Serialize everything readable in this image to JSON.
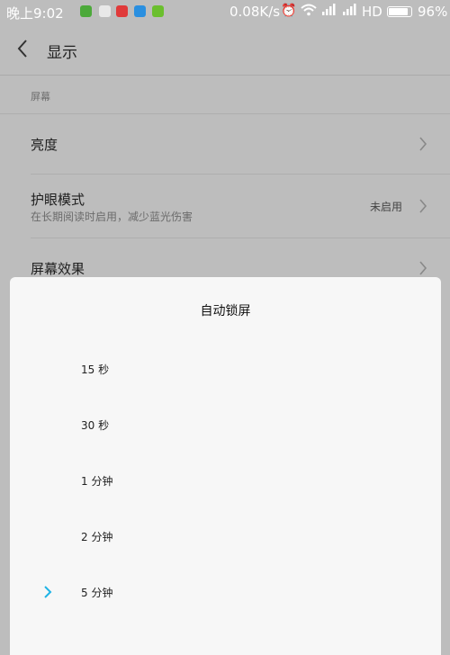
{
  "status_bar": {
    "time": "晚上9:02",
    "network_speed": "0.08K/s",
    "network_type": "HD",
    "battery_percent": "96%",
    "battery_level": 0.96,
    "icons": [
      "wechat-icon",
      "app-icon",
      "video-icon",
      "browser-icon",
      "app-icon",
      "alarm-icon",
      "wifi-icon",
      "signal-icon",
      "signal-icon"
    ]
  },
  "header": {
    "title": "显示",
    "back_icon": "chevron-left-icon"
  },
  "section": {
    "label": "屏幕"
  },
  "rows": [
    {
      "label": "亮度",
      "desc": "",
      "value": ""
    },
    {
      "label": "护眼模式",
      "desc": "在长期阅读时启用，减少蓝光伤害",
      "value": "未启用"
    },
    {
      "label": "屏幕效果",
      "desc": "",
      "value": ""
    }
  ],
  "dialog": {
    "title": "自动锁屏",
    "options": [
      {
        "label": "15 秒",
        "selected": false
      },
      {
        "label": "30 秒",
        "selected": false
      },
      {
        "label": "1 分钟",
        "selected": false
      },
      {
        "label": "2 分钟",
        "selected": false
      },
      {
        "label": "5 分钟",
        "selected": true
      }
    ]
  },
  "colors": {
    "accent": "#1fb4e6",
    "dim_background": "#bdbdbd",
    "dialog_background": "#f7f7f7"
  }
}
